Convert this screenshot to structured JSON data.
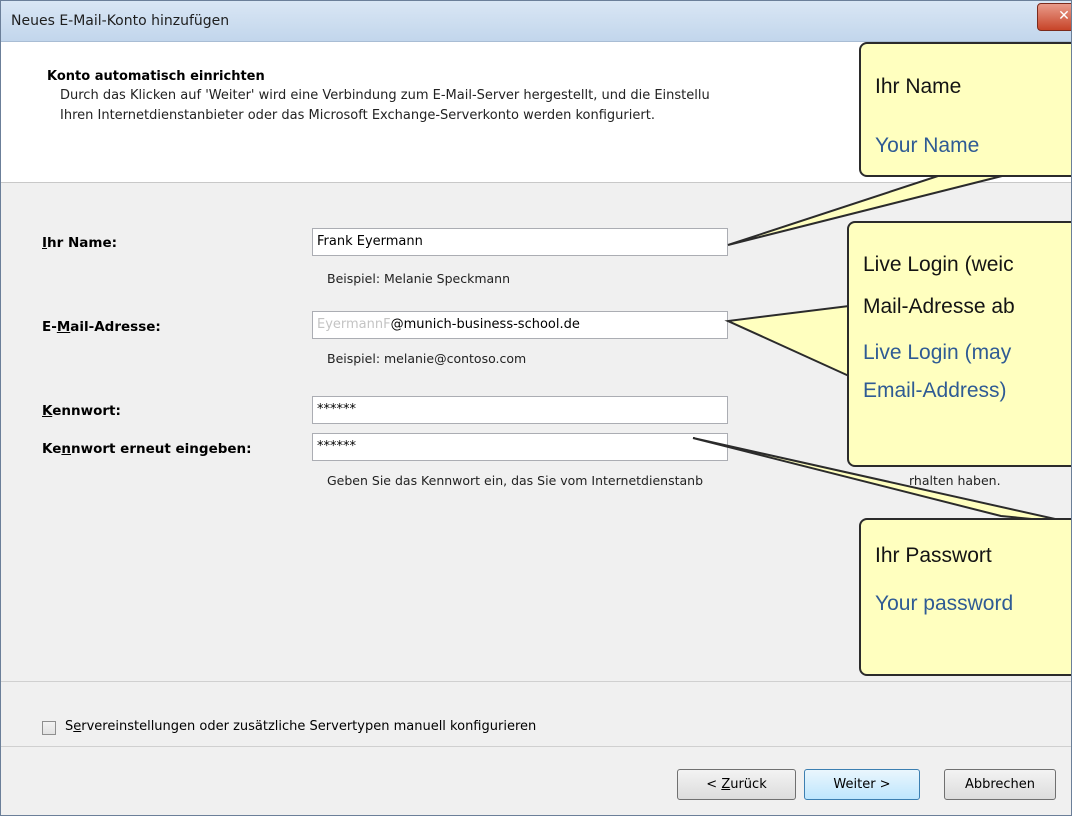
{
  "window": {
    "title": "Neues E-Mail-Konto hinzufügen",
    "close_glyph": "✕"
  },
  "header": {
    "title": "Konto automatisch einrichten",
    "line1": "Durch das Klicken auf 'Weiter' wird eine Verbindung zum E-Mail-Server hergestellt, und die Einstellu",
    "line2": "Ihren Internetdienstanbieter oder das Microsoft Exchange-Serverkonto werden konfiguriert."
  },
  "form": {
    "name_label_key": "I",
    "name_label_rest": "hr Name:",
    "name_value": "Frank Eyermann",
    "name_hint": "Beispiel: Melanie Speckmann",
    "email_label_pre": "E-",
    "email_label_key": "M",
    "email_label_rest": "ail-Adresse:",
    "email_value_ghost": "EyermannF",
    "email_value": "@munich-business-school.de",
    "email_hint": "Beispiel: melanie@contoso.com",
    "pw_label_key": "K",
    "pw_label_rest": "ennwort:",
    "pw_value": "******",
    "pw2_label_pre": "Ke",
    "pw2_label_key": "n",
    "pw2_label_rest": "nwort erneut eingeben:",
    "pw2_value": "******",
    "pw_hint": "Geben Sie das Kennwort ein, das Sie vom Internetdienstanb",
    "pw_hint_tail": "rhalten haben."
  },
  "manual": {
    "label_pre": "S",
    "label_key": "e",
    "label_rest": "rvereinstellungen oder zusätzliche Servertypen manuell konfigurieren",
    "checked": false
  },
  "buttons": {
    "back_pre": "< ",
    "back_key": "Z",
    "back_rest": "urück",
    "next": "Weiter >",
    "cancel": "Abbrechen"
  },
  "callouts": {
    "name": {
      "de": "Ihr Name",
      "en": "Your Name"
    },
    "login": {
      "de_line1": "Live Login (weic",
      "de_line2": "Mail-Adresse ab",
      "en_line1": "Live Login  (may",
      "en_line2": "Email-Address)"
    },
    "password": {
      "de": "Ihr Passwort",
      "en": "Your password"
    }
  },
  "colors": {
    "callout_fill": "#ffffbf",
    "callout_en_text": "#2f5b94"
  }
}
